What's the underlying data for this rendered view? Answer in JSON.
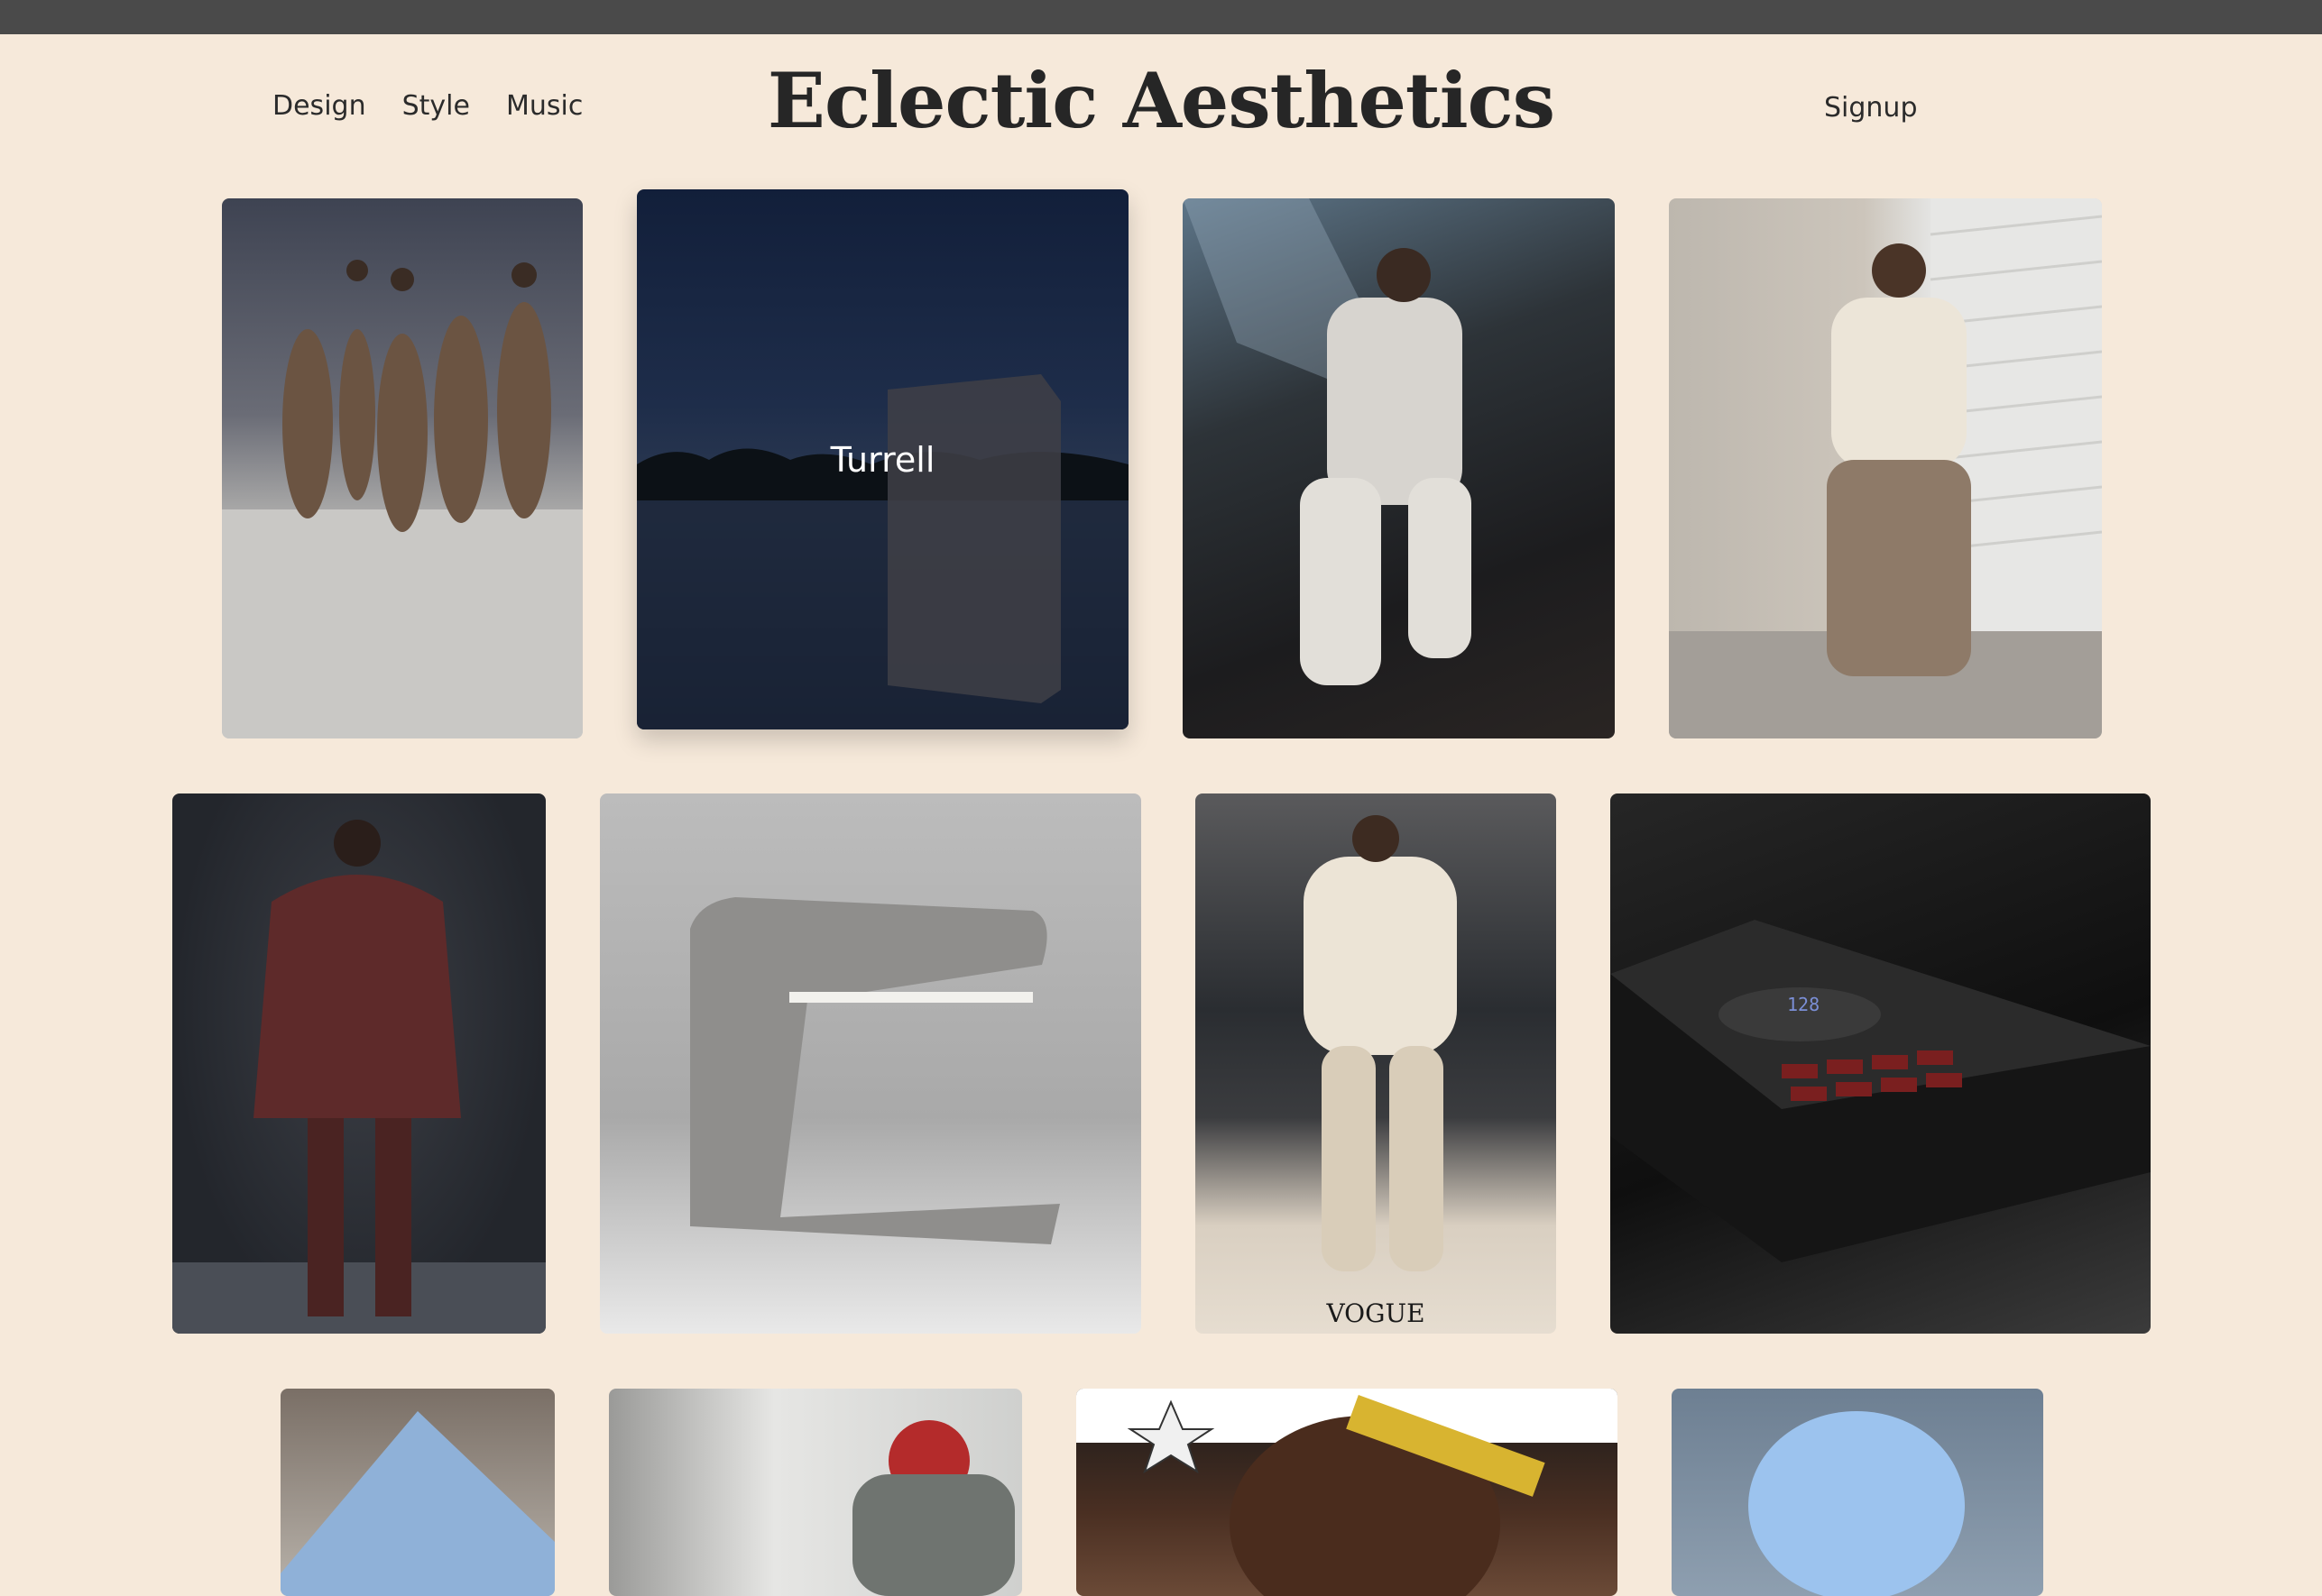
{
  "header": {
    "brand": "Eclectic Aesthetics",
    "nav": [
      "Design",
      "Style",
      "Music"
    ],
    "signup": "Signup"
  },
  "gallery": {
    "active_caption": "Turrell",
    "vogue_mark": "VOGUE",
    "sampler_display": "128"
  }
}
